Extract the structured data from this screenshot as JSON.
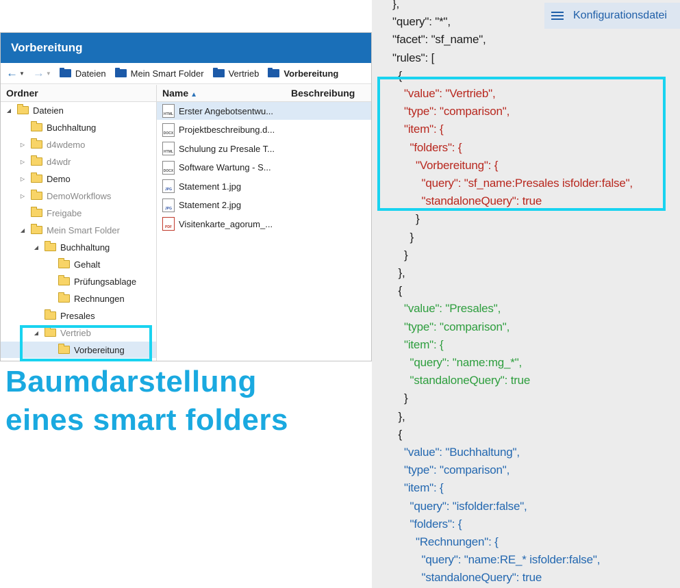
{
  "window": {
    "title": "Vorbereitung"
  },
  "toolbar": {
    "back_icon": "arrow-left-icon",
    "forward_icon": "arrow-right-icon",
    "breadcrumbs": [
      "Dateien",
      "Mein Smart Folder",
      "Vertrieb",
      "Vorbereitung"
    ]
  },
  "tree": {
    "header": "Ordner",
    "items": [
      {
        "label": "Dateien",
        "level": 0,
        "toggle": "expanded",
        "dim": false
      },
      {
        "label": "Buchhaltung",
        "level": 1,
        "toggle": "none",
        "dim": false
      },
      {
        "label": "d4wdemo",
        "level": 1,
        "toggle": "collapsed",
        "dim": true
      },
      {
        "label": "d4wdr",
        "level": 1,
        "toggle": "collapsed",
        "dim": true
      },
      {
        "label": "Demo",
        "level": 1,
        "toggle": "collapsed",
        "dim": false
      },
      {
        "label": "DemoWorkflows",
        "level": 1,
        "toggle": "collapsed",
        "dim": true
      },
      {
        "label": "Freigabe",
        "level": 1,
        "toggle": "none",
        "dim": true
      },
      {
        "label": "Mein Smart Folder",
        "level": 1,
        "toggle": "expanded",
        "dim": true
      },
      {
        "label": "Buchhaltung",
        "level": 2,
        "toggle": "expanded",
        "dim": false
      },
      {
        "label": "Gehalt",
        "level": 3,
        "toggle": "none",
        "dim": false
      },
      {
        "label": "Prüfungsablage",
        "level": 3,
        "toggle": "none",
        "dim": false
      },
      {
        "label": "Rechnungen",
        "level": 3,
        "toggle": "none",
        "dim": false
      },
      {
        "label": "Presales",
        "level": 2,
        "toggle": "none",
        "dim": false
      },
      {
        "label": "Vertrieb",
        "level": 2,
        "toggle": "expanded",
        "dim": true
      },
      {
        "label": "Vorbereitung",
        "level": 3,
        "toggle": "none",
        "dim": false,
        "selected": true
      }
    ]
  },
  "list": {
    "col_name": "Name",
    "col_desc": "Beschreibung",
    "sort_icon": "sort-ascending-icon",
    "files": [
      {
        "name": "Erster Angebotsentwu...",
        "type": "HTML",
        "selected": true
      },
      {
        "name": "Projektbeschreibung.d...",
        "type": "DOCX"
      },
      {
        "name": "Schulung zu Presale T...",
        "type": "HTML"
      },
      {
        "name": "Software Wartung - S...",
        "type": "DOCX"
      },
      {
        "name": "Statement 1.jpg",
        "type": "JPG"
      },
      {
        "name": "Statement 2.jpg",
        "type": "JPG"
      },
      {
        "name": "Visitenkarte_agorum_...",
        "type": "PDF"
      }
    ]
  },
  "caption": {
    "line1": "Baumdarstellung",
    "line2": "eines smart folders"
  },
  "config_button": {
    "label": "Konfigurationsdatei",
    "icon": "menu-lines-icon"
  },
  "code": {
    "colors": {
      "black": "#1e1e1e",
      "red": "#b8281f",
      "green": "#2e9e3e",
      "blue": "#2468b0",
      "highlight": "#19d3f0"
    },
    "lines": [
      {
        "text": "},",
        "indent": 0,
        "color": "black"
      },
      {
        "text": "\"query\": \"*\",",
        "indent": 0,
        "color": "black"
      },
      {
        "text": "\"facet\": \"sf_name\",",
        "indent": 0,
        "color": "black"
      },
      {
        "text": "\"rules\": [",
        "indent": 0,
        "color": "black"
      },
      {
        "text": "{",
        "indent": 1,
        "color": "black"
      },
      {
        "text": "\"value\": \"Vertrieb\",",
        "indent": 2,
        "color": "red"
      },
      {
        "text": "\"type\": \"comparison\",",
        "indent": 2,
        "color": "red"
      },
      {
        "text": "\"item\": {",
        "indent": 2,
        "color": "red"
      },
      {
        "text": "\"folders\": {",
        "indent": 3,
        "color": "red"
      },
      {
        "text": "\"Vorbereitung\": {",
        "indent": 4,
        "color": "red"
      },
      {
        "text": "\"query\": \"sf_name:Presales isfolder:false\",",
        "indent": 5,
        "color": "red"
      },
      {
        "text": "\"standaloneQuery\": true",
        "indent": 5,
        "color": "red"
      },
      {
        "text": "}",
        "indent": 4,
        "color": "black"
      },
      {
        "text": "}",
        "indent": 3,
        "color": "black"
      },
      {
        "text": "}",
        "indent": 2,
        "color": "black"
      },
      {
        "text": "},",
        "indent": 1,
        "color": "black"
      },
      {
        "text": "{",
        "indent": 1,
        "color": "black"
      },
      {
        "text": "\"value\": \"Presales\",",
        "indent": 2,
        "color": "green"
      },
      {
        "text": "\"type\": \"comparison\",",
        "indent": 2,
        "color": "green"
      },
      {
        "text": "\"item\": {",
        "indent": 2,
        "color": "green"
      },
      {
        "text": "\"query\": \"name:mg_*\",",
        "indent": 3,
        "color": "green"
      },
      {
        "text": "\"standaloneQuery\": true",
        "indent": 3,
        "color": "green"
      },
      {
        "text": "}",
        "indent": 2,
        "color": "black"
      },
      {
        "text": "},",
        "indent": 1,
        "color": "black"
      },
      {
        "text": "{",
        "indent": 1,
        "color": "black"
      },
      {
        "text": "\"value\": \"Buchhaltung\",",
        "indent": 2,
        "color": "blue"
      },
      {
        "text": "\"type\": \"comparison\",",
        "indent": 2,
        "color": "blue"
      },
      {
        "text": "\"item\": {",
        "indent": 2,
        "color": "blue"
      },
      {
        "text": "\"query\": \"isfolder:false\",",
        "indent": 3,
        "color": "blue"
      },
      {
        "text": "\"folders\": {",
        "indent": 3,
        "color": "blue"
      },
      {
        "text": "\"Rechnungen\": {",
        "indent": 4,
        "color": "blue"
      },
      {
        "text": "\"query\": \"name:RE_* isfolder:false\",",
        "indent": 5,
        "color": "blue"
      },
      {
        "text": "\"standaloneQuery\": true",
        "indent": 5,
        "color": "blue"
      }
    ]
  }
}
